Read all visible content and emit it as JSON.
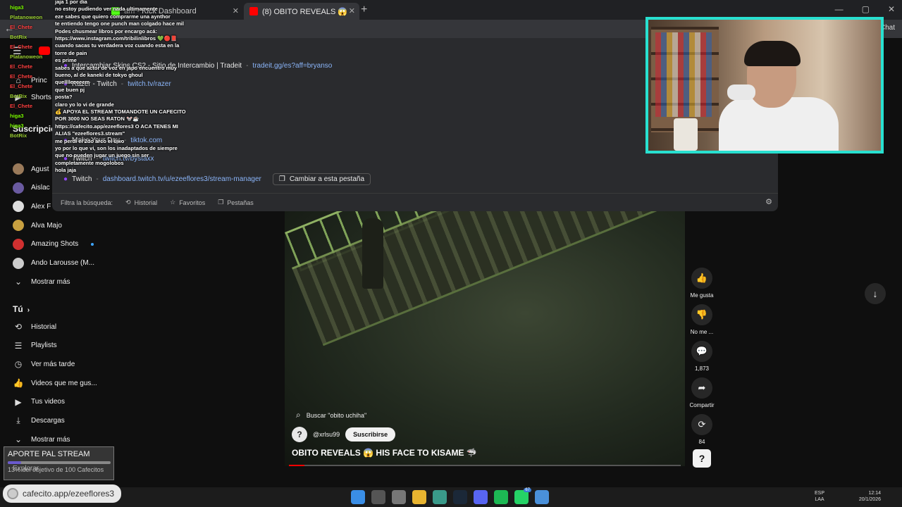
{
  "browser": {
    "tabs": [
      {
        "label": "Kick Dashboard",
        "partial_prefix": "am -"
      },
      {
        "label": "(8) OBITO REVEALS 😱 HIS FACE T"
      }
    ],
    "new_tab_symbol": "+",
    "chat_label": "Chat"
  },
  "omnibox": {
    "suggestions": [
      {
        "title": "Intercambiar Skins CS2 - Sitio de Intercambio | Tradeit",
        "url": "tradeit.gg/es?aff=bryanso"
      },
      {
        "title": "Razer - Twitch",
        "url": "twitch.tv/razer"
      },
      {
        "title": "Make Your Day",
        "url": "tiktok.com"
      },
      {
        "title": "Twitch",
        "url": "twitch.tv/bystaxx"
      },
      {
        "title": "Twitch",
        "url": "dashboard.twitch.tv/u/ezeeflores3/stream-manager",
        "action": "Cambiar a esta pestaña"
      }
    ],
    "filter_label": "Filtra la búsqueda:",
    "chips": [
      "Historial",
      "Favoritos",
      "Pestañas"
    ]
  },
  "sidebar": {
    "partial_items": [
      "Princ",
      "Shorts"
    ],
    "subscriptions_heading": "Suscripcion",
    "subscriptions": [
      {
        "label": "Agust",
        "color": "#9a7a5a"
      },
      {
        "label": "Aislac",
        "color": "#6a5aa0"
      },
      {
        "label": "Alex F",
        "color": "#dddddd"
      },
      {
        "label": "Alva Majo",
        "color": "#c8a040"
      },
      {
        "label": "Amazing Shots",
        "color": "#d03030",
        "new": true
      },
      {
        "label": "Ando Larousse (M...",
        "color": "#cccccc"
      },
      {
        "label": "Mostrar más",
        "icon": "chevron-down-icon"
      }
    ],
    "you_heading": "Tú",
    "you_items": [
      {
        "label": "Historial",
        "icon": "history-icon",
        "glyph": "⟲"
      },
      {
        "label": "Playlists",
        "icon": "playlists-icon",
        "glyph": "☰"
      },
      {
        "label": "Ver más tarde",
        "icon": "clock-icon",
        "glyph": "◷"
      },
      {
        "label": "Videos que me gus...",
        "icon": "thumbs-up-icon",
        "glyph": "👍"
      },
      {
        "label": "Tus videos",
        "icon": "your-videos-icon",
        "glyph": "▶"
      },
      {
        "label": "Descargas",
        "icon": "download-icon",
        "glyph": "⤓"
      },
      {
        "label": "Mostrar más",
        "icon": "chevron-down-icon",
        "glyph": "⌄"
      }
    ],
    "explore_label": "Explorar"
  },
  "short": {
    "search_text": "Buscar \"obito uchiha\"",
    "channel": "@xrlsu99",
    "subscribe_label": "Suscribirse",
    "title": "OBITO REVEALS 😱 HIS FACE TO KISAME 🦈",
    "progress": 0.04,
    "actions": [
      {
        "name": "like",
        "label": "Me gusta",
        "glyph": "👍"
      },
      {
        "name": "dislike",
        "label": "No me ...",
        "glyph": "👎"
      },
      {
        "name": "comments",
        "label": "1,873",
        "glyph": "💬"
      },
      {
        "name": "share",
        "label": "Compartir",
        "glyph": "➦"
      },
      {
        "name": "remix",
        "label": "84",
        "glyph": "⟳"
      }
    ],
    "help_symbol": "?"
  },
  "chat": {
    "lines": [
      "jaja 1 por dia",
      "no estoy pudiendo ver nada ultimamente",
      "eze sabes que quiero comprarme una aynthor",
      "te entiendo tengo one punch man colgado hace mil",
      "Podes chusmear libros por encargo acá:",
      "https://www.instagram.com/tribilinlibros 💚🔴📕",
      "cuando sacas tu verdadera voz cuando esta en la",
      "torre de pain",
      "es prime",
      "sabes a que actor de voz en japo encuentro muy",
      "bueno, al de kaneki de tokyo ghoul",
      "quelllleeeeem",
      "que buen pj",
      "posta?",
      "claro yo lo vi de grande",
      "💰 APOYA EL STREAM TOMANDOTE UN CAFECITO",
      "POR 3000 NO SEAS RATON 🐭☕",
      "https://cafecito.app/ezeeflores3 O ACA TENES MI",
      "ALIAS \"ezeeflores3.stream\"",
      "me perdi el 2do arco el uwo",
      "yo por lo que vi, son los inadaptados de siempre",
      "que no pueden jugar un juego sin ser",
      "completamente mogolobos",
      "hola jaja"
    ],
    "users": [
      {
        "name": "higa3",
        "color": "#7cfc00"
      },
      {
        "name": "Platanoweon",
        "color": "#9acd32"
      },
      {
        "name": "El_Chete",
        "color": "#ff4040"
      },
      {
        "name": "BotRix",
        "color": "#9acd32"
      },
      {
        "name": "El_Chete",
        "color": "#ff4040"
      },
      {
        "name": "Platanoweon",
        "color": "#9acd32"
      },
      {
        "name": "El_Chete",
        "color": "#ff4040"
      },
      {
        "name": "El_Chete",
        "color": "#ff4040"
      },
      {
        "name": "El_Chete",
        "color": "#ff4040"
      },
      {
        "name": "BotRix",
        "color": "#9acd32"
      },
      {
        "name": "El_Chete",
        "color": "#ff4040"
      },
      {
        "name": "higa3",
        "color": "#7cfc00"
      },
      {
        "name": "higa3",
        "color": "#7cfc00"
      },
      {
        "name": "BotRix",
        "color": "#9acd32"
      }
    ]
  },
  "donation": {
    "title": "APORTE PAL STREAM",
    "progress": 0.13,
    "subtitle": "13% del objetivo de 100 Cafecitos"
  },
  "link_pill": "cafecito.app/ezeeflores3",
  "taskbar": {
    "lang_top": "ESP",
    "lang_bottom": "LAA",
    "time": "12:14",
    "date": "20/1/2026",
    "whatsapp_badge": "67",
    "icons": [
      {
        "name": "start-icon",
        "color": "#3a8ee6"
      },
      {
        "name": "search-taskbar-icon",
        "color": "#555555"
      },
      {
        "name": "task-view-icon",
        "color": "#777777"
      },
      {
        "name": "file-explorer-icon",
        "color": "#e8b430"
      },
      {
        "name": "browser-icon",
        "color": "#3a9a8a"
      },
      {
        "name": "steam-icon",
        "color": "#1b2838"
      },
      {
        "name": "discord-icon",
        "color": "#5865f2"
      },
      {
        "name": "spotify-icon",
        "color": "#1db954"
      },
      {
        "name": "whatsapp-icon",
        "color": "#25d366"
      },
      {
        "name": "chat-app-icon",
        "color": "#4a90d9"
      }
    ]
  }
}
